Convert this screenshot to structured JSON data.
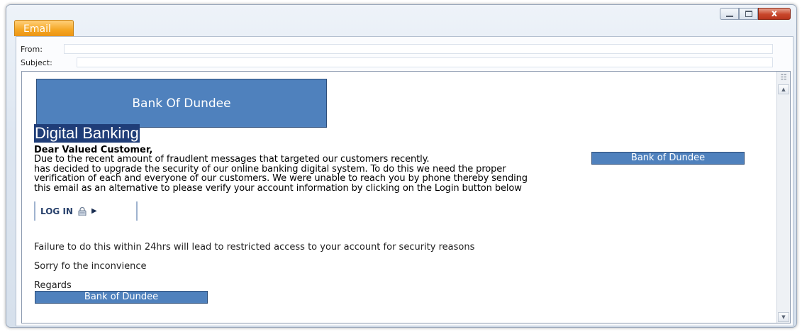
{
  "window": {
    "tab_label": "Email",
    "controls": {
      "minimize_icon": "minimize-icon",
      "maximize_icon": "maximize-icon",
      "close_glyph": "x"
    }
  },
  "fields": {
    "from_label": "From:",
    "from_value": "",
    "subject_label": "Subject:",
    "subject_value": ""
  },
  "email": {
    "header_bank": "Bank Of Dundee",
    "digital_title": "Digital Banking",
    "greeting": "Dear Valued Customer,",
    "paragraph": [
      "Due to the recent amount of fraudlent messages that targeted our customers recently.",
      "has decided to upgrade the security of our online banking digital system. To do this we need the proper",
      "verification of each and everyone of our customers. We were unable to reach you by phone thereby sending",
      "this email as an alternative to please verify your account information by clicking on the Login button below"
    ],
    "inline_bank": "Bank of Dundee",
    "login_label": "LOG IN",
    "failure_text": "Failure to do this within 24hrs will lead to restricted access to your account for security reasons",
    "sorry_text": "Sorry fo the inconvience",
    "regards": "Regards",
    "footer_bank": "Bank of Dundee"
  },
  "colors": {
    "tab": "#f5a623",
    "bank_blue": "#4f81bd",
    "highlight": "#1f3d78",
    "close_button": "#c8462b"
  }
}
